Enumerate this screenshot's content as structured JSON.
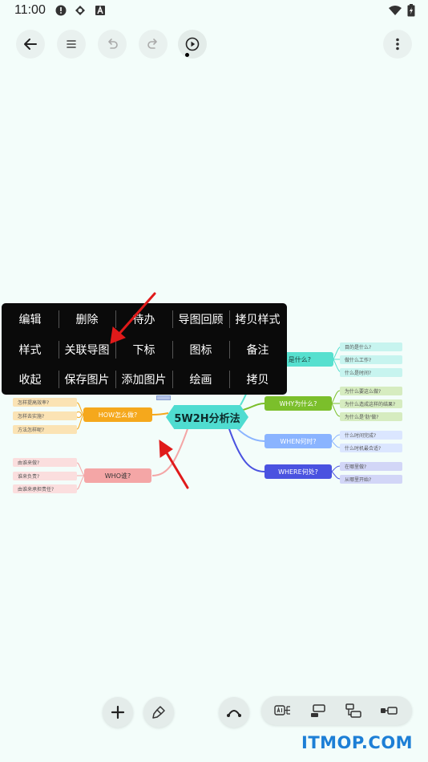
{
  "status": {
    "time": "11:00"
  },
  "menu": {
    "row1": [
      "编辑",
      "删除",
      "待办",
      "导图回顾",
      "拷贝样式"
    ],
    "row2": [
      "样式",
      "关联导图",
      "下标",
      "图标",
      "备注"
    ],
    "row3": [
      "收起",
      "保存图片",
      "添加图片",
      "绘画",
      "拷贝"
    ]
  },
  "mindmap": {
    "root": "5W2H分析法",
    "what": {
      "label": "是什么?",
      "leaves": [
        "目的是什么?",
        "做什么工作?",
        "什么是时间?"
      ]
    },
    "why": {
      "label": "WHY为什么?",
      "leaves": [
        "为什么要这么做?",
        "为什么造成这样的结果?",
        "为什么是'肋'做?"
      ]
    },
    "when": {
      "label": "WHEN何时?",
      "leaves": [
        "什么时间完成?",
        "什么时机最合适?"
      ]
    },
    "where": {
      "label": "WHERE何处?",
      "leaves": [
        "在哪里做?",
        "从哪里开始?"
      ]
    },
    "how": {
      "label": "HOW怎么做?",
      "leaves": [
        "怎样提高效率?",
        "怎样去实施?",
        "方法怎样呢?"
      ]
    },
    "who": {
      "label": "WHO谁?",
      "leaves": [
        "由谁来做?",
        "谁来负责?",
        "由谁来承担责任?"
      ]
    }
  },
  "watermark": "ITMOP.COM",
  "colors": {
    "background": "#f3fdfa",
    "menu_bg": "#0a0a0a",
    "root": "#4fdcd0",
    "what": "#57e0cf",
    "why": "#7bbf2b",
    "when": "#8ab4ff",
    "where": "#4a52e0",
    "how": "#f5a81c",
    "who": "#f4a6a6",
    "arrow": "#e01a1a",
    "watermark": "#1d7fd6"
  }
}
